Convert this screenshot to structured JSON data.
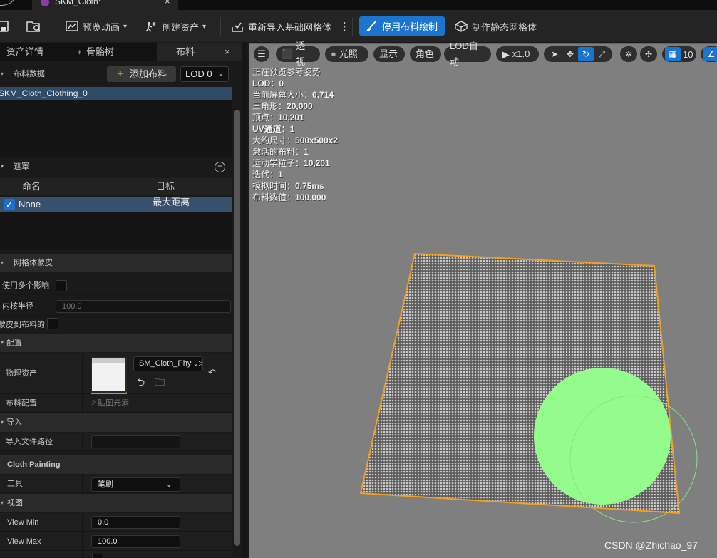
{
  "tab": {
    "title": "SKM_Cloth*"
  },
  "toolbar": {
    "preview_anim": "预览动画",
    "create_asset": "创建资产",
    "reimport": "重新导入基础网格体",
    "paint_toggle": "停用布料绘制",
    "static_mesh": "制作静态网格体"
  },
  "panel_tabs": {
    "details": "资产详情",
    "skeleton": "骨骼树",
    "cloth": "布料"
  },
  "cloth_data": {
    "header": "布料数据",
    "add_button": "添加布料",
    "lod_select": "LOD 0",
    "items": [
      "SKM_Cloth_Clothing_0"
    ]
  },
  "masks": {
    "header": "遮罩",
    "col_name": "命名",
    "col_target": "目标",
    "rows": [
      {
        "name": "None",
        "target": "最大距离"
      }
    ]
  },
  "mesh_skin": {
    "header": "网格体蒙皮",
    "multi_influence": "使用多个影响",
    "kernel_radius": "内核半径",
    "kernel_radius_value": "100.0",
    "skin_to_cloth": "蒙皮到布料的"
  },
  "config": {
    "header": "配置",
    "physics_asset": "物理资产",
    "physics_asset_value": "SM_Cloth_PhysicsAsset",
    "cloth_config": "布料配置",
    "cloth_config_value": "2 贴图元素"
  },
  "import": {
    "header": "导入",
    "file_path": "导入文件路径"
  },
  "painting": {
    "header": "Cloth Painting",
    "tool_label": "工具",
    "tool_value": "笔刷"
  },
  "view": {
    "header": "视图",
    "view_min_label": "View Min",
    "view_min": "0.0",
    "view_max_label": "View Max",
    "view_max": "100.0"
  },
  "viewport_toolbar": {
    "perspective": "透视",
    "lit": "光照",
    "show": "显示",
    "character": "角色",
    "lod_auto": "LOD自动",
    "play_rate": "x1.0",
    "grid_size": "10"
  },
  "stats": [
    {
      "label": "正在预览参考姿势",
      "value": ""
    },
    {
      "label": "LOD：",
      "value": "0"
    },
    {
      "label": "当前屏幕大小：",
      "value": "0.714"
    },
    {
      "label": "三角形：",
      "value": "20,000"
    },
    {
      "label": "顶点：",
      "value": "10,201"
    },
    {
      "label": "UV通道：",
      "value": "1"
    },
    {
      "label": "大约尺寸：",
      "value": "500x500x2"
    },
    {
      "label": "激活的布料：",
      "value": "1"
    },
    {
      "label": "运动学粒子：",
      "value": "10,201"
    },
    {
      "label": "迭代：",
      "value": "1"
    },
    {
      "label": "模拟时间：",
      "value": "0.75ms"
    },
    {
      "label": "布料数值：",
      "value": "100.000"
    }
  ],
  "watermark": "CSDN @Zhichao_97",
  "colors": {
    "accent": "#1b75d0",
    "paint": "#94fc8c",
    "selection_outline": "#f0a022",
    "viewport_bg": "#807f80"
  }
}
